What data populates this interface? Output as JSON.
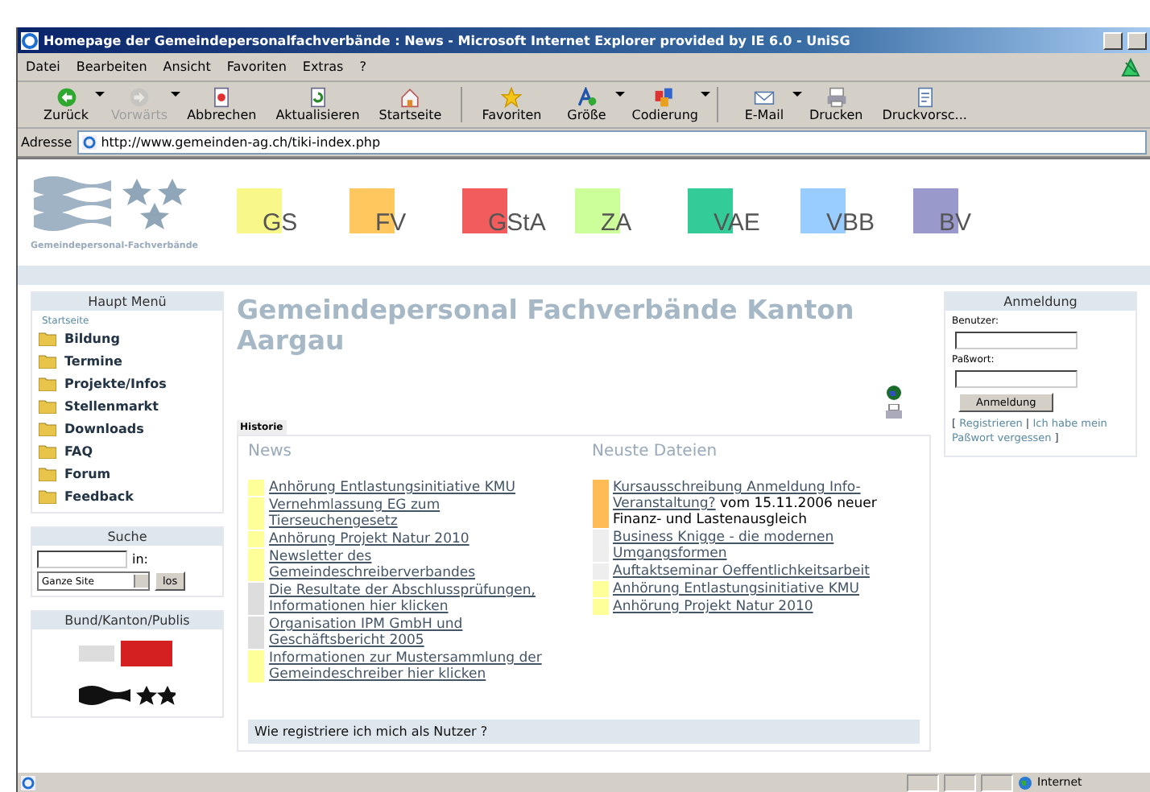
{
  "window": {
    "title": "Homepage der Gemeindepersonalfachverbände : News - Microsoft Internet Explorer provided by IE 6.0 - UniSG"
  },
  "menu_bar": [
    "Datei",
    "Bearbeiten",
    "Ansicht",
    "Favoriten",
    "Extras",
    "?"
  ],
  "toolbar": [
    {
      "label": "Zurück",
      "disabled": false,
      "dropdown": true
    },
    {
      "label": "Vorwärts",
      "disabled": true,
      "dropdown": true
    },
    {
      "label": "Abbrechen",
      "disabled": false,
      "dropdown": false
    },
    {
      "label": "Aktualisieren",
      "disabled": false,
      "dropdown": false
    },
    {
      "label": "Startseite",
      "disabled": false,
      "dropdown": false
    },
    {
      "label": "Favoriten",
      "disabled": false,
      "dropdown": false
    },
    {
      "label": "Größe",
      "disabled": false,
      "dropdown": true
    },
    {
      "label": "Codierung",
      "disabled": false,
      "dropdown": true
    },
    {
      "label": "E-Mail",
      "disabled": false,
      "dropdown": true
    },
    {
      "label": "Drucken",
      "disabled": false,
      "dropdown": false
    },
    {
      "label": "Druckvorsc...",
      "disabled": false,
      "dropdown": false
    }
  ],
  "address_bar": {
    "label": "Adresse",
    "value": "http://www.gemeinden-ag.ch/tiki-index.php"
  },
  "header": {
    "logo_caption": "Gemeindepersonal-Fachverbände",
    "tabs": [
      {
        "label": "GS",
        "color": "#f7f78a"
      },
      {
        "label": "FV",
        "color": "#ffc75e"
      },
      {
        "label": "GStA",
        "color": "#f25c5c"
      },
      {
        "label": "ZA",
        "color": "#ccff99"
      },
      {
        "label": "VAE",
        "color": "#33cc99"
      },
      {
        "label": "VBB",
        "color": "#99ccff"
      },
      {
        "label": "BV",
        "color": "#9999cc"
      }
    ]
  },
  "main_menu": {
    "title": "Haupt Menü",
    "home_link": "Startseite",
    "items": [
      "Bildung",
      "Termine",
      "Projekte/Infos",
      "Stellenmarkt",
      "Downloads",
      "FAQ",
      "Forum",
      "Feedback"
    ]
  },
  "search": {
    "title": "Suche",
    "in_label": "in:",
    "scope": "Ganze Site",
    "button": "los"
  },
  "partners": {
    "title": "Bund/Kanton/Publis"
  },
  "page_title": "Gemeindepersonal Fachverbände Kanton Aargau",
  "history_tab": "Historie",
  "news": {
    "title": "News",
    "items": [
      {
        "text": "Anhörung Entlastungsinitiative KMU",
        "color": "#ffff99"
      },
      {
        "text": "Vernehmlassung EG zum Tierseuchengesetz",
        "color": "#ffff99"
      },
      {
        "text": "Anhörung Projekt Natur 2010",
        "color": "#ffff99"
      },
      {
        "text": "Newsletter des Gemeindeschreiberverbandes",
        "color": "#ffff99"
      },
      {
        "text": "Die Resultate der Abschlussprüfungen, Informationen hier klicken",
        "color": "#dddddd"
      },
      {
        "text": "Organisation IPM GmbH und Geschäftsbericht 2005",
        "color": "#dddddd"
      },
      {
        "text": "Informationen zur Mustersammlung der Gemeindeschreiber hier klicken",
        "color": "#ffff99"
      }
    ]
  },
  "files": {
    "title": "Neuste Dateien",
    "items": [
      {
        "link": "Kursausschreibung Anmeldung Info-Veranstaltung?",
        "text": "vom 15.11.2006 neuer Finanz- und Lastenausgleich",
        "color": "#ffbb55"
      },
      {
        "link": "Business Knigge - die modernen Umgangsformen",
        "color": "#eeeeee"
      },
      {
        "link": "Auftaktseminar Oeffentlichkeitsarbeit",
        "color": "#eeeeee"
      },
      {
        "link": "Anhörung Entlastungsinitiative KMU",
        "color": "#ffff99"
      },
      {
        "link": "Anhörung Projekt Natur 2010",
        "color": "#ffff99"
      }
    ]
  },
  "faq_bar": "Wie registriere ich mich als Nutzer ?",
  "login": {
    "title": "Anmeldung",
    "user_label": "Benutzer:",
    "password_label": "Paßwort:",
    "button": "Anmeldung",
    "open_bracket": "[",
    "register_link": "Registrieren",
    "separator": "|",
    "forgot_link": "Ich habe mein Paßwort vergessen",
    "close_bracket": "]"
  },
  "status_bar": {
    "zone": "Internet"
  }
}
